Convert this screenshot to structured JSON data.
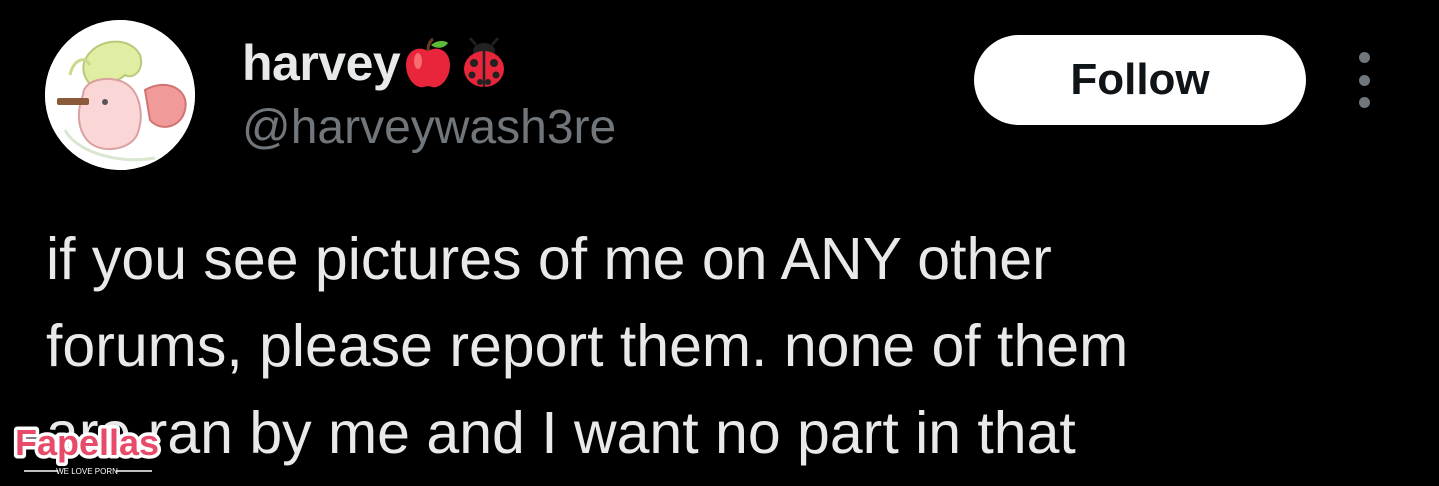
{
  "author": {
    "display_name": "harvey",
    "name_emojis": [
      "apple-emoji",
      "ladybug-emoji"
    ],
    "handle": "@harveywash3re",
    "avatar_icon": "pony-avatar"
  },
  "actions": {
    "follow_label": "Follow",
    "more_icon": "more-vertical-icon"
  },
  "tweet": {
    "lines": [
      "if you see pictures of me on ANY other",
      "forums, please report them. none of them",
      "are ran by me and I want no part in that"
    ]
  },
  "watermark": {
    "brand": "Fapellas",
    "tagline": "WE LOVE PORN",
    "brand_color": "#e84a6a"
  },
  "colors": {
    "background": "#000000",
    "primary_text": "#e7e9ea",
    "secondary_text": "#71767b",
    "button_bg": "#ffffff",
    "button_text": "#0f1419"
  }
}
